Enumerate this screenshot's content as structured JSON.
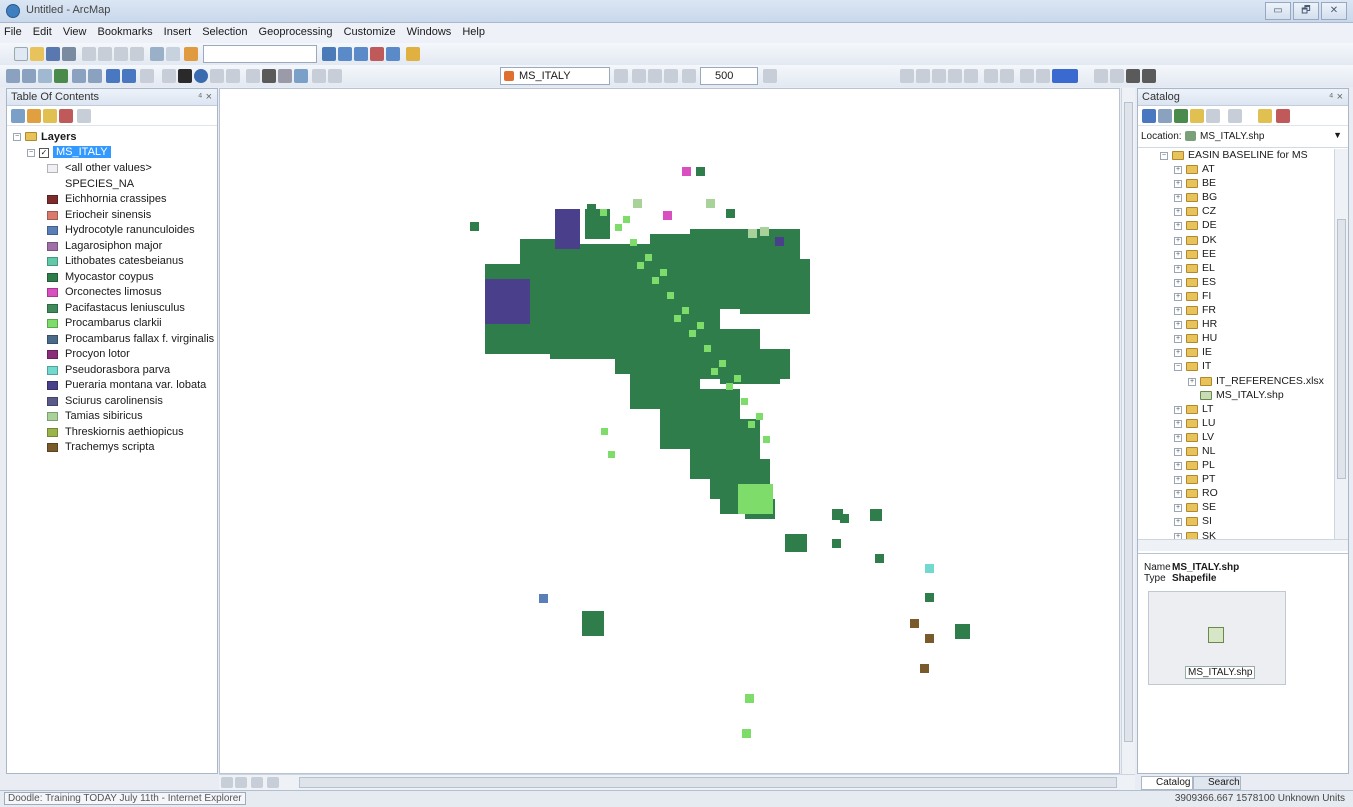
{
  "window": {
    "title": "Untitled - ArcMap",
    "buttons": [
      "▭",
      "🗗",
      "✕"
    ]
  },
  "menu": [
    "File",
    "Edit",
    "View",
    "Bookmarks",
    "Insert",
    "Selection",
    "Geoprocessing",
    "Customize",
    "Windows",
    "Help"
  ],
  "toolbar": {
    "layer_combo": "MS_ITALY",
    "zoom_value": "500"
  },
  "toc": {
    "title": "Table Of Contents",
    "root": "Layers",
    "layer": "MS_ITALY",
    "other_values": "<all other values>",
    "field": "SPECIES_NA",
    "legend": [
      {
        "label": "Eichhornia crassipes",
        "color": "#7d2b2b"
      },
      {
        "label": "Eriocheir sinensis",
        "color": "#d97a6c"
      },
      {
        "label": "Hydrocotyle ranunculoides",
        "color": "#5a7fb8"
      },
      {
        "label": "Lagarosiphon major",
        "color": "#a06fa8"
      },
      {
        "label": "Lithobates catesbeianus",
        "color": "#5fc9a8"
      },
      {
        "label": "Myocastor coypus",
        "color": "#2f7d4a"
      },
      {
        "label": "Orconectes limosus",
        "color": "#d94fc0"
      },
      {
        "label": "Pacifastacus leniusculus",
        "color": "#3f8a5a"
      },
      {
        "label": "Procambarus clarkii",
        "color": "#7ddc6a"
      },
      {
        "label": "Procambarus fallax f. virginalis",
        "color": "#4a6a8a"
      },
      {
        "label": "Procyon lotor",
        "color": "#8a2e7a"
      },
      {
        "label": "Pseudorasbora parva",
        "color": "#72d9cf"
      },
      {
        "label": "Pueraria montana var. lobata",
        "color": "#4a3f8a"
      },
      {
        "label": "Sciurus carolinensis",
        "color": "#5a5a8a"
      },
      {
        "label": "Tamias sibiricus",
        "color": "#a8d29a"
      },
      {
        "label": "Threskiornis aethiopicus",
        "color": "#9ab44a"
      },
      {
        "label": "Trachemys scripta",
        "color": "#7a5a2a"
      }
    ]
  },
  "catalog": {
    "title": "Catalog",
    "location_label": "Location:",
    "location_value": "MS_ITALY.shp",
    "root": "EASIN BASELINE for MS",
    "folders_before": [
      "AT",
      "BE",
      "BG",
      "CZ",
      "DE",
      "DK",
      "EE",
      "EL",
      "ES",
      "FI",
      "FR",
      "HR",
      "HU",
      "IE"
    ],
    "expanded": "IT",
    "expanded_children": [
      "IT_REFERENCES.xlsx",
      "MS_ITALY.shp"
    ],
    "folders_after": [
      "LT",
      "LU",
      "LV",
      "NL",
      "PL",
      "PT",
      "RO",
      "SE",
      "SI",
      "SK"
    ],
    "name_label": "Name",
    "name_value": "MS_ITALY.shp",
    "type_label": "Type",
    "type_value": "Shapefile",
    "thumb_caption": "MS_ITALY.shp",
    "tabs": [
      "Catalog",
      "Search"
    ]
  },
  "status": {
    "taskbar_item": "Doodle: Training TODAY July 11th - Internet Explorer",
    "coords": "3909366.667  1578100 Unknown Units"
  },
  "colors": {
    "accent": "#3399ff",
    "map_main": "#2f7d4a"
  }
}
